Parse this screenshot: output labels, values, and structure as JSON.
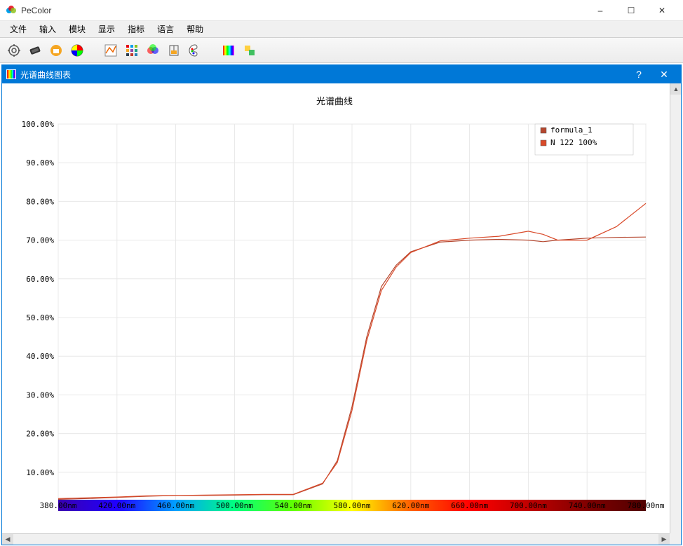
{
  "window": {
    "title": "PeColor",
    "min": "–",
    "max": "☐",
    "close": "✕"
  },
  "menus": [
    "文件",
    "输入",
    "模块",
    "显示",
    "指标",
    "语言",
    "帮助"
  ],
  "subwindow": {
    "title": "光谱曲线图表",
    "help": "?",
    "close": "✕"
  },
  "chart_data": {
    "type": "line",
    "title": "光谱曲线",
    "xlabel": "",
    "ylabel": "",
    "xlim": [
      380,
      780
    ],
    "ylim": [
      0,
      100
    ],
    "yticks": [
      0,
      10,
      20,
      30,
      40,
      50,
      60,
      70,
      80,
      90,
      100
    ],
    "ytick_labels": [
      "",
      "10.00%",
      "20.00%",
      "30.00%",
      "40.00%",
      "50.00%",
      "60.00%",
      "70.00%",
      "80.00%",
      "90.00%",
      "100.00%"
    ],
    "xticks": [
      380,
      420,
      460,
      500,
      540,
      580,
      620,
      660,
      700,
      740,
      780
    ],
    "xtick_labels": [
      "380.00nm",
      "420.00nm",
      "460.00nm",
      "500.00nm",
      "540.00nm",
      "580.00nm",
      "620.00nm",
      "660.00nm",
      "700.00nm",
      "740.00nm",
      "780.00nm"
    ],
    "x": [
      380,
      400,
      420,
      440,
      460,
      480,
      500,
      520,
      540,
      560,
      570,
      580,
      590,
      600,
      610,
      620,
      640,
      660,
      680,
      700,
      710,
      720,
      740,
      760,
      780
    ],
    "series": [
      {
        "name": "formula_1",
        "color": "#b5472f",
        "values": [
          3.0,
          3.2,
          3.5,
          3.8,
          4.0,
          4.0,
          4.1,
          4.2,
          4.2,
          7.0,
          13.0,
          27.0,
          45.0,
          58.0,
          63.5,
          67.0,
          69.5,
          70.0,
          70.2,
          70.0,
          69.6,
          70.0,
          70.5,
          70.7,
          70.8
        ]
      },
      {
        "name": "N 122 100%",
        "color": "#d94a2a",
        "values": [
          3.2,
          3.4,
          3.6,
          3.9,
          4.0,
          4.1,
          4.2,
          4.3,
          4.3,
          7.2,
          12.5,
          26.0,
          44.0,
          57.0,
          63.0,
          66.8,
          69.8,
          70.5,
          71.0,
          72.3,
          71.5,
          70.0,
          70.0,
          73.5,
          79.5
        ]
      }
    ],
    "spectrum_stops": [
      {
        "nm": 380,
        "c": "#3a00b0"
      },
      {
        "nm": 420,
        "c": "#2000ff"
      },
      {
        "nm": 460,
        "c": "#00a0ff"
      },
      {
        "nm": 500,
        "c": "#00ff80"
      },
      {
        "nm": 540,
        "c": "#60ff00"
      },
      {
        "nm": 580,
        "c": "#ffff00"
      },
      {
        "nm": 620,
        "c": "#ff6000"
      },
      {
        "nm": 660,
        "c": "#ff0000"
      },
      {
        "nm": 700,
        "c": "#c00000"
      },
      {
        "nm": 740,
        "c": "#800000"
      },
      {
        "nm": 780,
        "c": "#500000"
      }
    ]
  }
}
